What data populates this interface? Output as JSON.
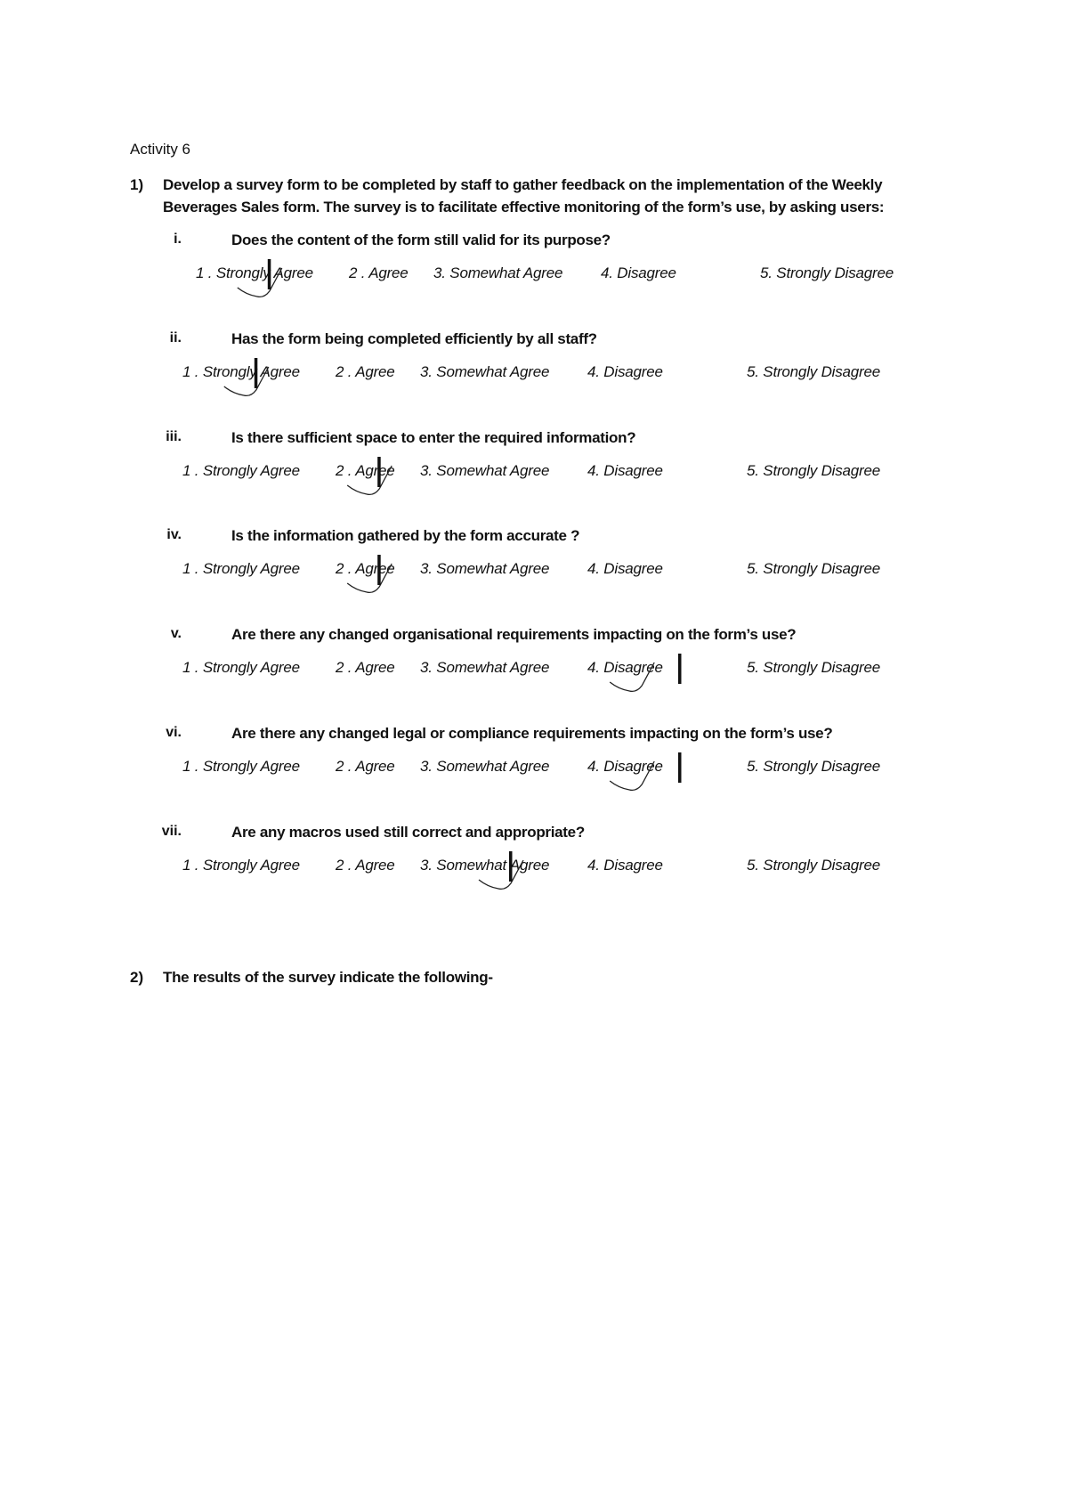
{
  "document": {
    "title": "Activity 6",
    "part1": {
      "number": "1)",
      "line1": "Develop a survey form to be completed by staff to gather feedback on the implementation of the Weekly",
      "line2": "Beverages Sales form. The survey is to facilitate effective monitoring of the form’s use, by asking users:"
    },
    "questions": [
      {
        "numeral": "i.",
        "text": "Does the content of the form still valid for its purpose?",
        "selected": 1
      },
      {
        "numeral": "ii.",
        "text": "Has  the form being completed efficiently by all staff?",
        "selected": 1
      },
      {
        "numeral": "iii.",
        "text": "Is  there sufficient space to enter the required information?",
        "selected": 2
      },
      {
        "numeral": "iv.",
        "text": "Is the information gathered by the form accurate ?",
        "selected": 2
      },
      {
        "numeral": "v.",
        "text": "Are there  any changed organisational requirements  impacting on the form’s use?",
        "selected": 4
      },
      {
        "numeral": "vi.",
        "text": "Are  there  any changed legal or compliance requirements  impacting on the form’s use?",
        "selected": 4
      },
      {
        "numeral": "vii.",
        "text": "Are  any macros used  still correct and appropriate?",
        "selected": 3
      }
    ],
    "options": [
      "1 . Strongly Agree",
      "2 . Agree",
      "3. Somewhat Agree",
      "4. Disagree",
      "5. Strongly Disagree"
    ],
    "part2": {
      "number": "2)",
      "text": "The results of the survey indicate the following-"
    }
  }
}
